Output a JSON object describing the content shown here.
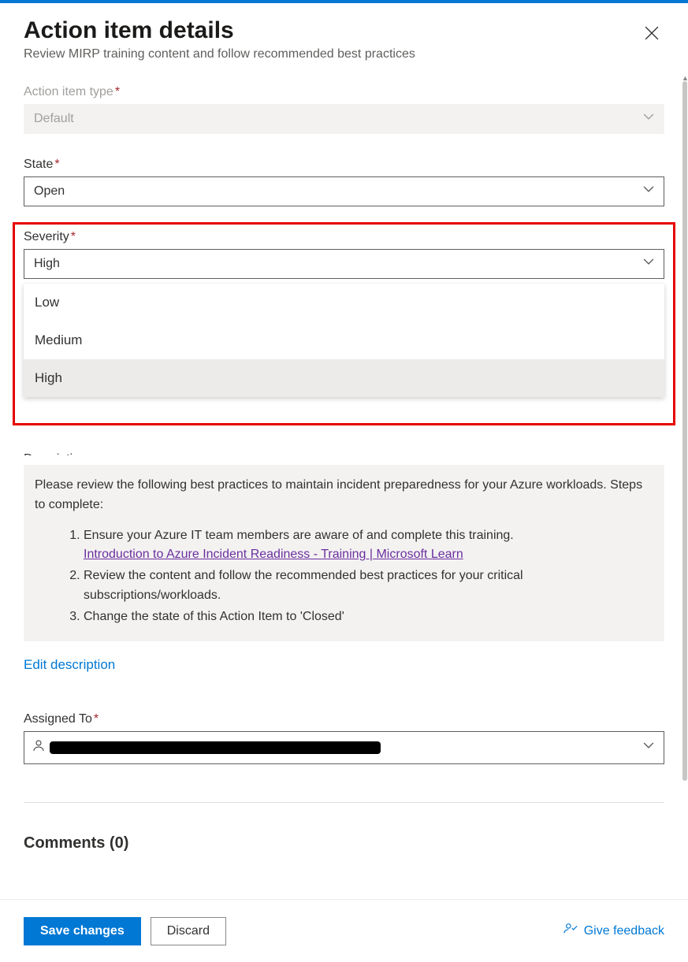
{
  "header": {
    "title": "Action item details",
    "subtitle": "Review MIRP training content and follow recommended best practices"
  },
  "fields": {
    "action_item_type": {
      "label": "Action item type",
      "value": "Default"
    },
    "state": {
      "label": "State",
      "value": "Open"
    },
    "severity": {
      "label": "Severity",
      "value": "High",
      "options": [
        "Low",
        "Medium",
        "High"
      ]
    },
    "description": {
      "hidden_label": "Description",
      "intro": "Please review the following best practices to maintain incident preparedness for your Azure workloads. Steps to complete:",
      "steps": {
        "s1": "Ensure your Azure IT team members are aware of and complete this training.",
        "link": "Introduction to Azure Incident Readiness - Training | Microsoft Learn",
        "s2": "Review the content and follow the recommended best practices for your critical subscriptions/workloads.",
        "s3": "Change the state of this Action Item to 'Closed'"
      },
      "edit_link": "Edit description"
    },
    "assigned_to": {
      "label": "Assigned To"
    }
  },
  "comments": {
    "title": "Comments (0)"
  },
  "footer": {
    "save": "Save changes",
    "discard": "Discard",
    "feedback": "Give feedback"
  }
}
